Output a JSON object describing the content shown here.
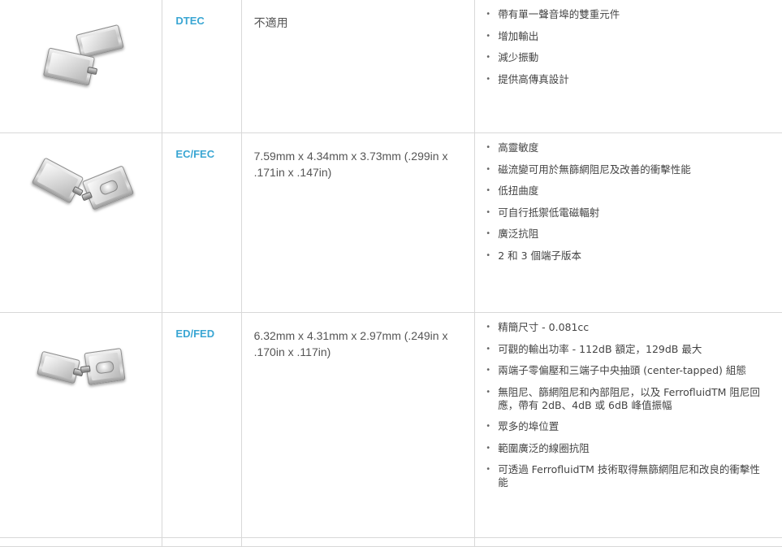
{
  "rows": [
    {
      "name": "DTEC",
      "dimensions": "不適用",
      "features": [
        "帶有單一聲音埠的雙重元件",
        "增加輸出",
        "減少振動",
        "提供高傳真設計"
      ]
    },
    {
      "name": "EC/FEC",
      "dimensions": "7.59mm x 4.34mm x 3.73mm (.299in x .171in x .147in)",
      "features": [
        "高靈敏度",
        "磁流變可用於無篩網阻尼及改善的衝擊性能",
        "低扭曲度",
        "可自行抵禦低電磁輻射",
        "廣泛抗阻",
        "2 和 3 個端子版本"
      ]
    },
    {
      "name": "ED/FED",
      "dimensions": "6.32mm x 4.31mm x 2.97mm (.249in x .170in x .117in)",
      "features": [
        "精簡尺寸 - 0.081cc",
        "可觀的輸出功率 - 112dB 額定，129dB 最大",
        "兩端子零偏壓和三端子中央抽頭 (center-tapped) 組態",
        "無阻尼、篩網阻尼和內部阻尼，以及 FerrofluidTM 阻尼回應，帶有 2dB、4dB 或 6dB 峰值振幅",
        "眾多的埠位置",
        "範圍廣泛的線圈抗阻",
        "可透過 FerrofluidTM 技術取得無篩網阻尼和改良的衝擊性能"
      ]
    }
  ]
}
